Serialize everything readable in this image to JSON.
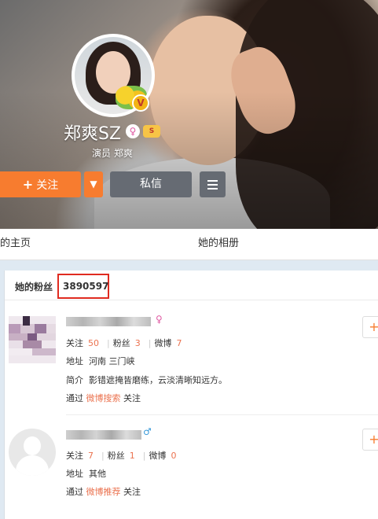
{
  "profile": {
    "name": "郑爽SZ",
    "subtitle": "演员 郑爽",
    "verified_badge": "V",
    "level_badge": "S",
    "gender_icon": "female-icon"
  },
  "actions": {
    "follow_plus": "+",
    "follow_label": "关注",
    "dropdown_icon": "▼",
    "message_label": "私信",
    "menu_icon": "hamburger-menu-icon"
  },
  "nav": {
    "home_partial": "的主页",
    "album": "她的相册"
  },
  "fans_panel": {
    "label": "她的粉丝",
    "count": "3890597",
    "highlight_color": "#e02b20"
  },
  "fans": [
    {
      "gender_symbol": "♀",
      "stats": {
        "follow_label": "关注",
        "follow": "50",
        "fans_label": "粉丝",
        "fans": "3",
        "weibo_label": "微博",
        "weibo": "7"
      },
      "location_label": "地址",
      "location": "河南 三门峡",
      "bio_label": "简介",
      "bio": "影错遮掩皆磨练，云淡清晰知远方。",
      "via_label": "通过",
      "via_source": "微博搜索",
      "via_suffix": "关注",
      "add_label": "+"
    },
    {
      "gender_symbol": "♂",
      "stats": {
        "follow_label": "关注",
        "follow": "7",
        "fans_label": "粉丝",
        "fans": "1",
        "weibo_label": "微博",
        "weibo": "0"
      },
      "location_label": "地址",
      "location": "其他",
      "via_label": "通过",
      "via_source": "微博推荐",
      "via_suffix": "关注",
      "add_label": "+"
    }
  ],
  "colors": {
    "accent_orange": "#f77c2f",
    "link_orange": "#eb7350",
    "button_gray": "#666b73",
    "female_pink": "#e05aa3",
    "male_blue": "#3a9ad9"
  }
}
